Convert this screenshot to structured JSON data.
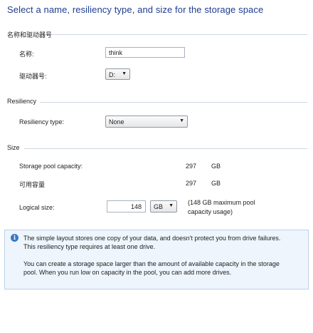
{
  "page": {
    "title": "Select a name, resiliency type, and size for the storage space"
  },
  "groups": {
    "name_drive": {
      "heading": "名称和驱动器号",
      "name_label": "名称:",
      "name_value": "think",
      "drive_label": "驱动器号:",
      "drive_value": "D:"
    },
    "resiliency": {
      "heading": "Resiliency",
      "type_label": "Resiliency type:",
      "type_value": "None"
    },
    "size": {
      "heading": "Size",
      "pool_capacity_label": "Storage pool capacity:",
      "pool_capacity_value": "297",
      "pool_capacity_unit": "GB",
      "available_label": "可用容量",
      "available_value": "297",
      "available_unit": "GB",
      "logical_size_label": "Logical size:",
      "logical_size_value": "148",
      "logical_size_unit": "GB",
      "logical_size_note_line1": "(148 GB maximum pool",
      "logical_size_note_line2": "capacity usage)"
    }
  },
  "info_note": {
    "icon": "info-icon",
    "line1": "The simple layout stores one copy of your data, and doesn't protect you from drive failures.",
    "line2": "This resiliency type requires at least one drive.",
    "line3": "You can create a storage space larger than the amount of available capacity in the storage",
    "line4": "pool. When you run low on capacity in the pool, you can add more drives."
  },
  "colors": {
    "title": "#1e3d8f",
    "info_box_bg": "#eef5fc",
    "info_icon": "#3a78c9"
  }
}
